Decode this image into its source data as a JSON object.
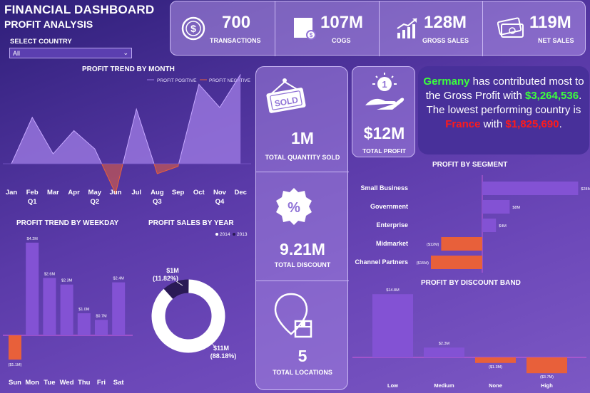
{
  "header": {
    "title": "FINANCIAL DASHBOARD",
    "subtitle": "PROFIT ANALYSIS"
  },
  "filter": {
    "label": "SELECT COUNTRY",
    "value": "All"
  },
  "kpis": [
    {
      "value": "700",
      "label": "TRANSACTIONS",
      "icon": "dollar-coin-icon"
    },
    {
      "value": "107M",
      "label": "COGS",
      "icon": "box-icon"
    },
    {
      "value": "128M",
      "label": "GROSS SALES",
      "icon": "growth-chart-icon"
    },
    {
      "value": "119M",
      "label": "NET SALES",
      "icon": "cash-icon"
    }
  ],
  "middle": {
    "qty": {
      "value": "1M",
      "label": "TOTAL QUANTITY SOLD",
      "icon": "sold-sign-icon",
      "sign": "SOLD"
    },
    "discount": {
      "value": "9.21M",
      "label": "TOTAL DISCOUNT",
      "icon": "percent-badge-icon"
    },
    "locations": {
      "value": "5",
      "label": "TOTAL LOCATIONS",
      "icon": "location-pin-icon"
    }
  },
  "profit": {
    "value": "$12M",
    "label": "TOTAL PROFIT",
    "icon": "hand-coin-icon",
    "coin": "1"
  },
  "insight": {
    "country_best": "Germany",
    "text1": " has contributed most to the Gross Profit with ",
    "best_value": "$3,264,536",
    "text2": ". The lowest performing country is ",
    "country_worst": "France",
    "text3": " with ",
    "worst_value": "$1,825,690",
    "text4": "."
  },
  "chart_data": [
    {
      "type": "area",
      "title": "PROFIT TREND BY MONTH",
      "legend": [
        "PROFIT POSITIVE",
        "PROFIT NEGATIVE"
      ],
      "categories": [
        "Jan",
        "Feb",
        "Mar",
        "Apr",
        "May",
        "Jun",
        "Jul",
        "Aug",
        "Sep",
        "Oct",
        "Nov",
        "Dec"
      ],
      "quarters": [
        "Q1",
        "Q2",
        "Q3",
        "Q4"
      ],
      "values": [
        0.0,
        1.4,
        0.3,
        1.0,
        0.45,
        -0.9,
        1.65,
        -0.3,
        -0.08,
        2.4,
        1.7,
        2.7
      ],
      "colors": {
        "positive": "#a07ee6",
        "negative": "#e8603a"
      }
    },
    {
      "type": "bar",
      "title": "PROFIT TREND BY WEEKDAY",
      "categories": [
        "Sun",
        "Mon",
        "Tue",
        "Wed",
        "Thu",
        "Fri",
        "Sat"
      ],
      "values": [
        -1.1,
        4.2,
        2.6,
        2.3,
        1.0,
        0.7,
        2.4
      ],
      "labels": [
        "($1.1M)",
        "$4.2M",
        "$2.6M",
        "$2.3M",
        "$1.0M",
        "$0.7M",
        "$2.4M"
      ]
    },
    {
      "type": "pie",
      "title": "PROFIT SALES BY YEAR",
      "legend": [
        "2014",
        "2013"
      ],
      "slices": [
        {
          "name": "2014",
          "value": 88.18,
          "label": "$11M",
          "pct": "(88.18%)",
          "color": "#ffffff"
        },
        {
          "name": "2013",
          "value": 11.82,
          "label": "$1M",
          "pct": "(11.82%)",
          "color": "#2a1a55"
        }
      ]
    },
    {
      "type": "bar",
      "title": "PROFIT BY SEGMENT",
      "orientation": "horizontal",
      "categories": [
        "Small Business",
        "Government",
        "Enterprise",
        "Midmarket",
        "Channel Partners"
      ],
      "values": [
        28,
        8,
        4,
        -12,
        -15
      ],
      "labels": [
        "$28M",
        "$8M",
        "$4M",
        "($12M)",
        "($15M)"
      ]
    },
    {
      "type": "bar",
      "title": "PROFIT BY DISCOUNT BAND",
      "categories": [
        "Low",
        "Medium",
        "None",
        "High"
      ],
      "values": [
        14.8,
        2.3,
        -1.3,
        -3.7
      ],
      "labels": [
        "$14.8M",
        "$2.3M",
        "($1.3M)",
        "($3.7M)"
      ]
    }
  ],
  "colors": {
    "bar": "#8352d4",
    "negative": "#e8603a",
    "axis": "#c05ad6"
  }
}
